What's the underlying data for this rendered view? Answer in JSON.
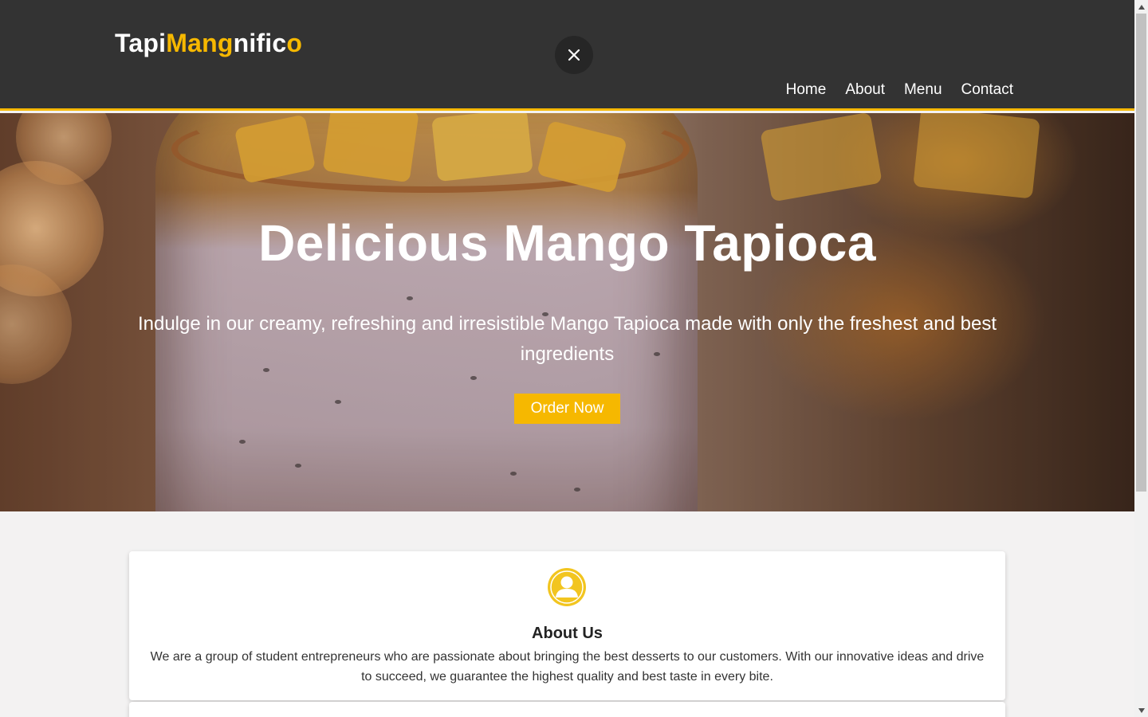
{
  "header": {
    "logo_parts": [
      "Tapi",
      "Mang",
      "nific",
      "o"
    ],
    "close_icon": "close-icon",
    "nav": [
      {
        "label": "Home"
      },
      {
        "label": "About"
      },
      {
        "label": "Menu"
      },
      {
        "label": "Contact"
      }
    ]
  },
  "hero": {
    "title": "Delicious Mango Tapioca",
    "subtitle": "Indulge in our creamy, refreshing and irresistible Mango Tapioca made with only the freshest and best ingredients",
    "cta_label": "Order Now"
  },
  "about": {
    "icon": "user-icon",
    "title": "About Us",
    "text": "We are a group of student entrepreneurs who are passionate about bringing the best desserts to our customers. With our innovative ideas and drive to succeed, we guarantee the highest quality and best taste in every bite."
  },
  "colors": {
    "accent": "#f6b800",
    "header_bg": "#333333",
    "page_bg": "#f3f2f2"
  }
}
